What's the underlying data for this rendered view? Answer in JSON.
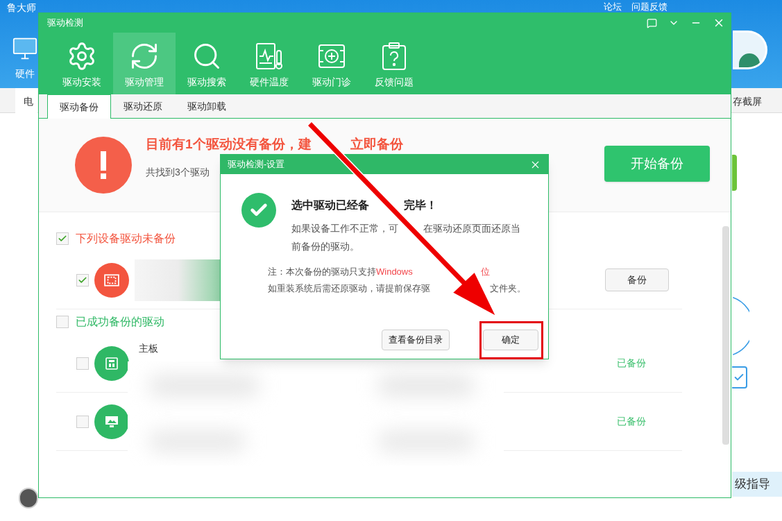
{
  "background_app": {
    "title": "鲁大师",
    "top_links": [
      "论坛",
      "问题反馈"
    ],
    "side_label": "硬件",
    "tab_fragment": "电",
    "right_tab_fragment": "存截屏",
    "bottom_right_fragment": "级指导",
    "side_checkbox": {
      "checked": true
    }
  },
  "window": {
    "title": "驱动检测"
  },
  "toolbar": [
    {
      "label": "驱动安装",
      "kind": "gear",
      "selected": false
    },
    {
      "label": "驱动管理",
      "kind": "refresh",
      "selected": true
    },
    {
      "label": "驱动搜索",
      "kind": "search",
      "selected": false
    },
    {
      "label": "硬件温度",
      "kind": "thermo",
      "selected": false
    },
    {
      "label": "驱动门诊",
      "kind": "clinic",
      "selected": false
    },
    {
      "label": "反馈问题",
      "kind": "question",
      "selected": false
    }
  ],
  "subtabs": [
    {
      "label": "驱动备份",
      "selected": true
    },
    {
      "label": "驱动还原",
      "selected": false
    },
    {
      "label": "驱动卸载",
      "selected": false
    }
  ],
  "alert": {
    "title": [
      "目前有1个驱动没有备份，建",
      "立即备份"
    ],
    "text": "共找到3个驱动"
  },
  "start_button": "开始备份",
  "sections": [
    {
      "label": "下列设备驱动未备份",
      "checked": true,
      "color": "#f3553f",
      "rows": [
        {
          "checked": true,
          "kind": "video",
          "action": "备份"
        }
      ]
    },
    {
      "label": "已成功备份的驱动",
      "checked": false,
      "color": "#2fb865",
      "rows": [
        {
          "name": "主板",
          "checked": false,
          "kind": "board",
          "state": "已备份"
        },
        {
          "checked": false,
          "kind": "display",
          "state": "已备份"
        }
      ]
    }
  ],
  "dialog": {
    "title": "驱动检测-设置",
    "heading": [
      "选中驱动已经备",
      "完毕！"
    ],
    "body_lines": [
      [
        "如果设备工作不正常，可",
        "在驱动还原页面还原当"
      ],
      [
        "前备份的驱动。"
      ]
    ],
    "note_lines": [
      [
        {
          "text": "注：本次备份的驱动只支持",
          "highlight": false
        },
        {
          "text": "Windows",
          "highlight": true
        },
        {
          "text": "位",
          "highlight": true
        }
      ],
      [
        {
          "text": "如重装系统后需还原驱动，请提前保存驱",
          "highlight": false
        },
        {
          "text": "文件夹。",
          "highlight": false
        }
      ]
    ],
    "buttons": [
      "查看备份目录",
      "确定"
    ]
  }
}
